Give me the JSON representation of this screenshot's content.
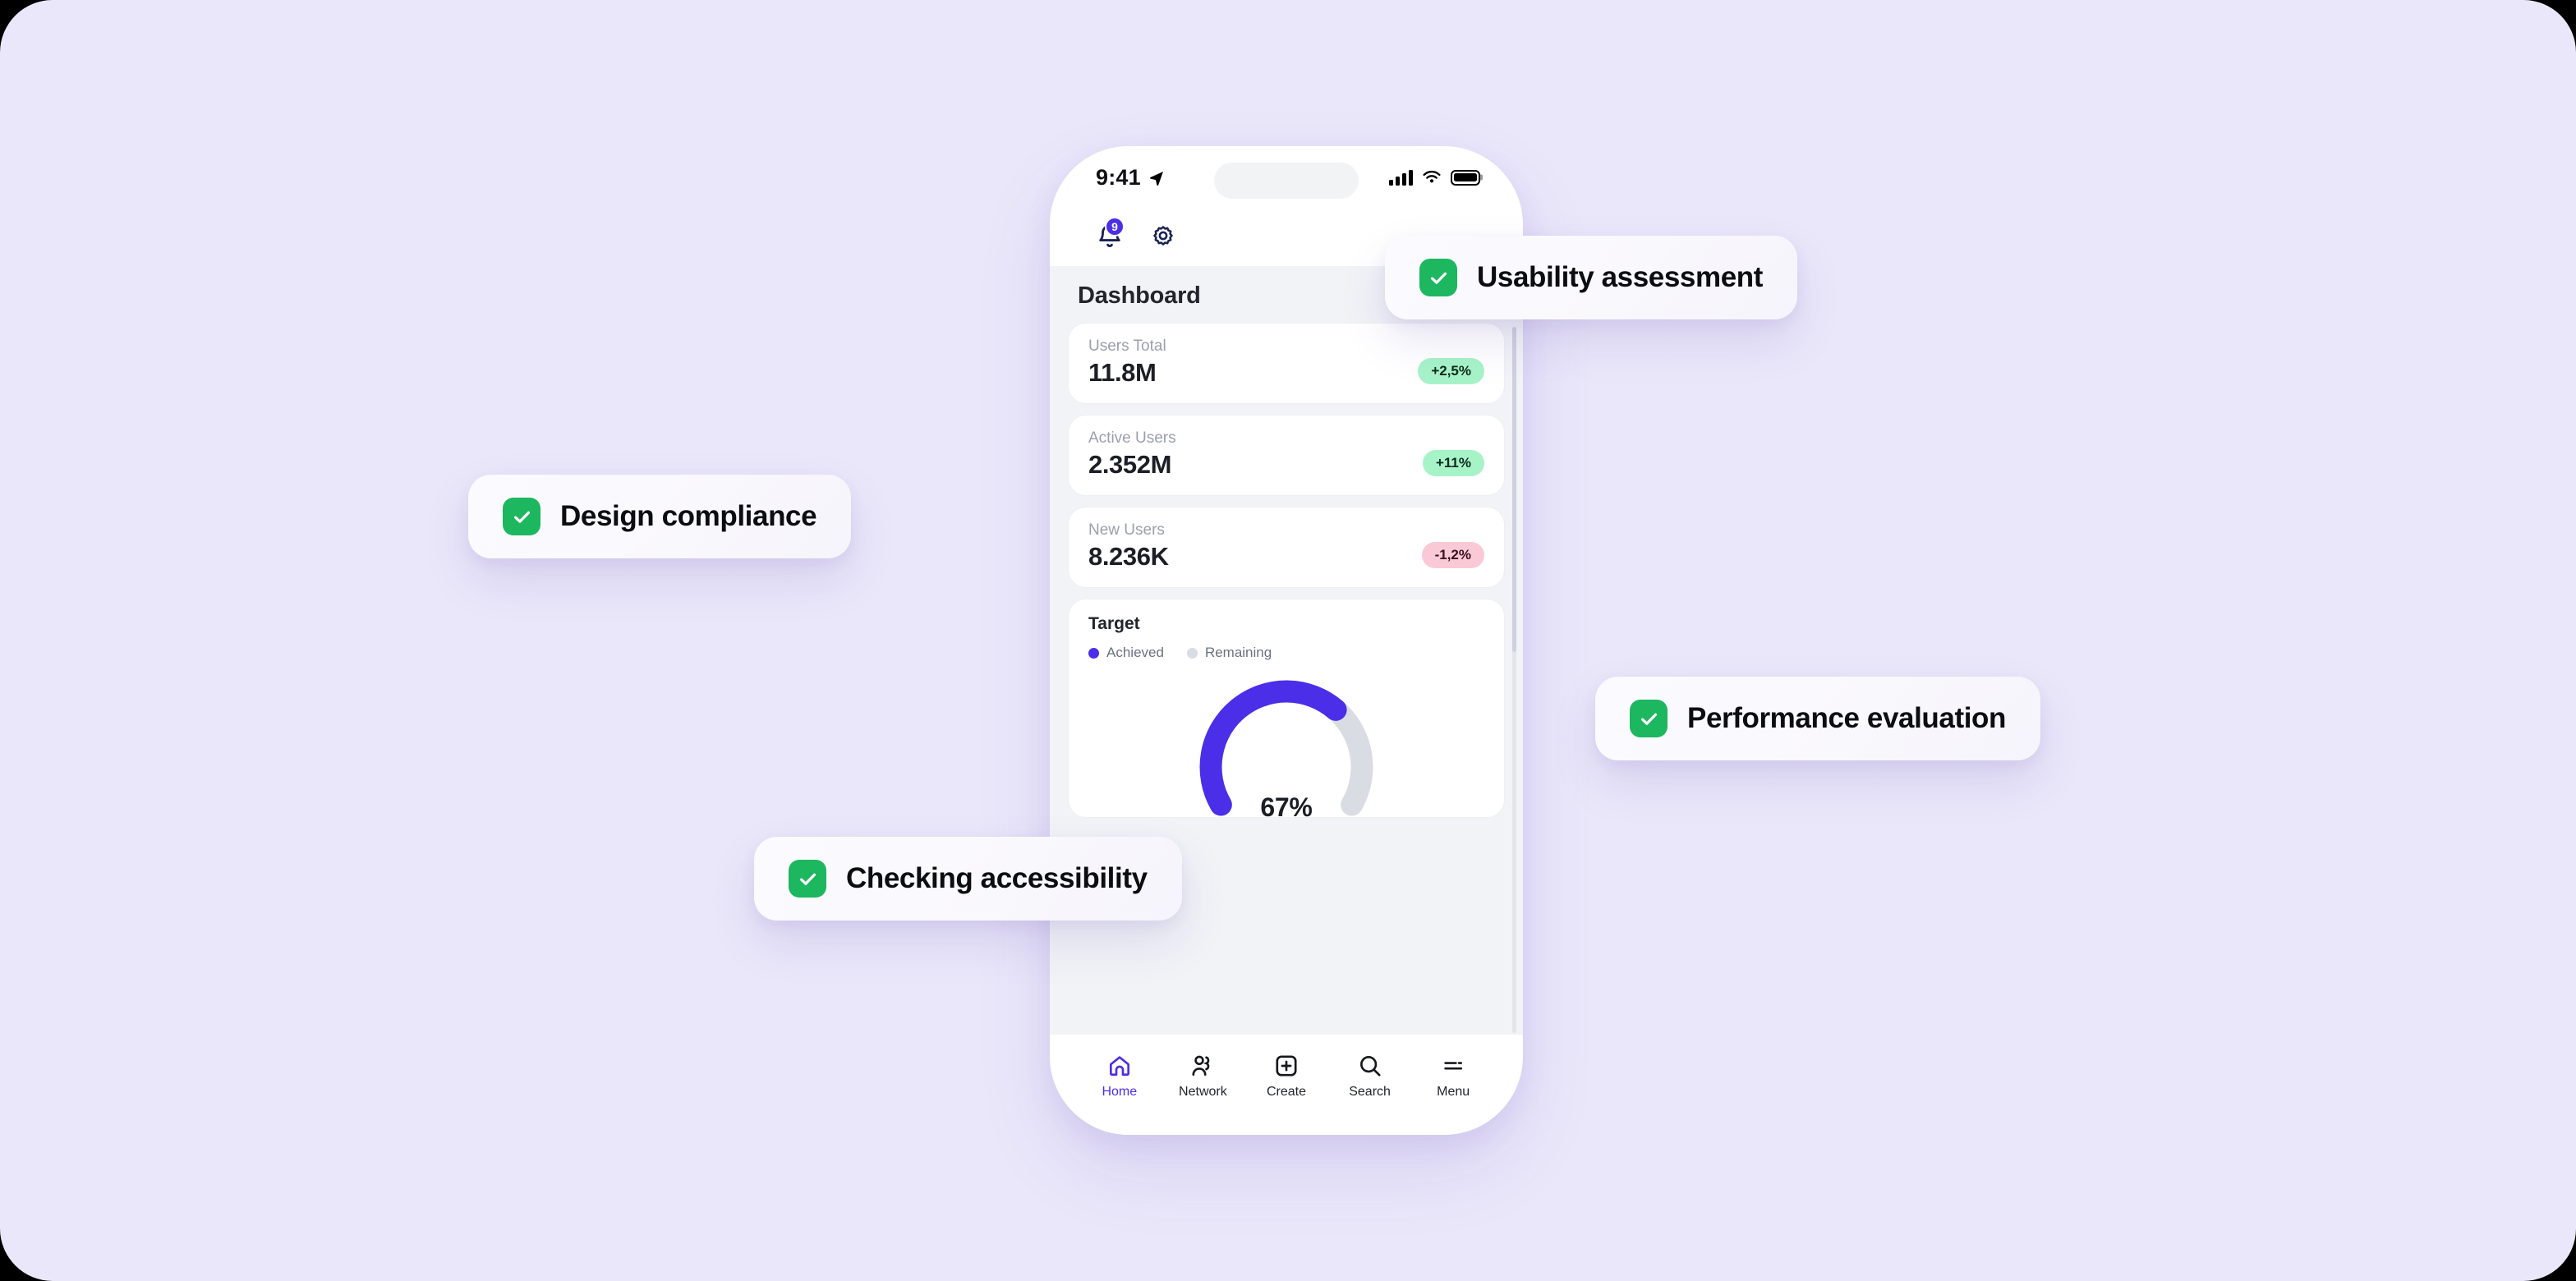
{
  "theme": {
    "canvas_bg": "#EAE7FA",
    "accent_purple": "#4B2EE8",
    "check_green": "#1DB760",
    "badge_up_bg": "#A7F3C8",
    "badge_down_bg": "#FAC9D6",
    "screen_bg": "#F1F3F7"
  },
  "phone": {
    "status_bar": {
      "time": "9:41",
      "location_icon": "location-arrow-icon",
      "signal_icon": "cellular-signal-icon",
      "wifi_icon": "wifi-icon",
      "battery_icon": "battery-full-icon"
    },
    "app_header": {
      "notifications_icon": "bell-icon",
      "notifications_count": "9",
      "settings_icon": "gear-icon"
    },
    "page_title": "Dashboard",
    "stats": [
      {
        "label": "Users Total",
        "value": "11.8M",
        "delta": "+2,5%",
        "direction": "up"
      },
      {
        "label": "Active Users",
        "value": "2.352M",
        "delta": "+11%",
        "direction": "up"
      },
      {
        "label": "New Users",
        "value": "8.236K",
        "delta": "-1,2%",
        "direction": "down"
      }
    ],
    "target": {
      "title": "Target",
      "legend": [
        {
          "label": "Achieved",
          "color": "#4B2EE8"
        },
        {
          "label": "Remaining",
          "color": "#D9DCE3"
        }
      ],
      "percent_label": "67%"
    },
    "tabbar": [
      {
        "label": "Home",
        "icon": "home-icon",
        "active": true
      },
      {
        "label": "Network",
        "icon": "network-icon",
        "active": false
      },
      {
        "label": "Create",
        "icon": "create-icon",
        "active": false
      },
      {
        "label": "Search",
        "icon": "search-icon",
        "active": false
      },
      {
        "label": "Menu",
        "icon": "menu-icon",
        "active": false
      }
    ]
  },
  "chips": [
    {
      "id": "usability",
      "label": "Usability assessment",
      "icon": "check-icon"
    },
    {
      "id": "design",
      "label": "Design compliance",
      "icon": "check-icon"
    },
    {
      "id": "performance",
      "label": "Performance evaluation",
      "icon": "check-icon"
    },
    {
      "id": "accessibility",
      "label": "Checking accessibility",
      "icon": "check-icon"
    }
  ],
  "chart_data": {
    "type": "pie",
    "title": "Target",
    "subtype": "gauge-donut",
    "labels": [
      "Achieved",
      "Remaining"
    ],
    "values": [
      67,
      33
    ],
    "colors": [
      "#4B2EE8",
      "#D9DCE3"
    ],
    "center_label": "67%",
    "unit": "%",
    "start_angle_deg": 150,
    "sweep_deg": 240,
    "legend_position": "top-left",
    "grid": false
  }
}
